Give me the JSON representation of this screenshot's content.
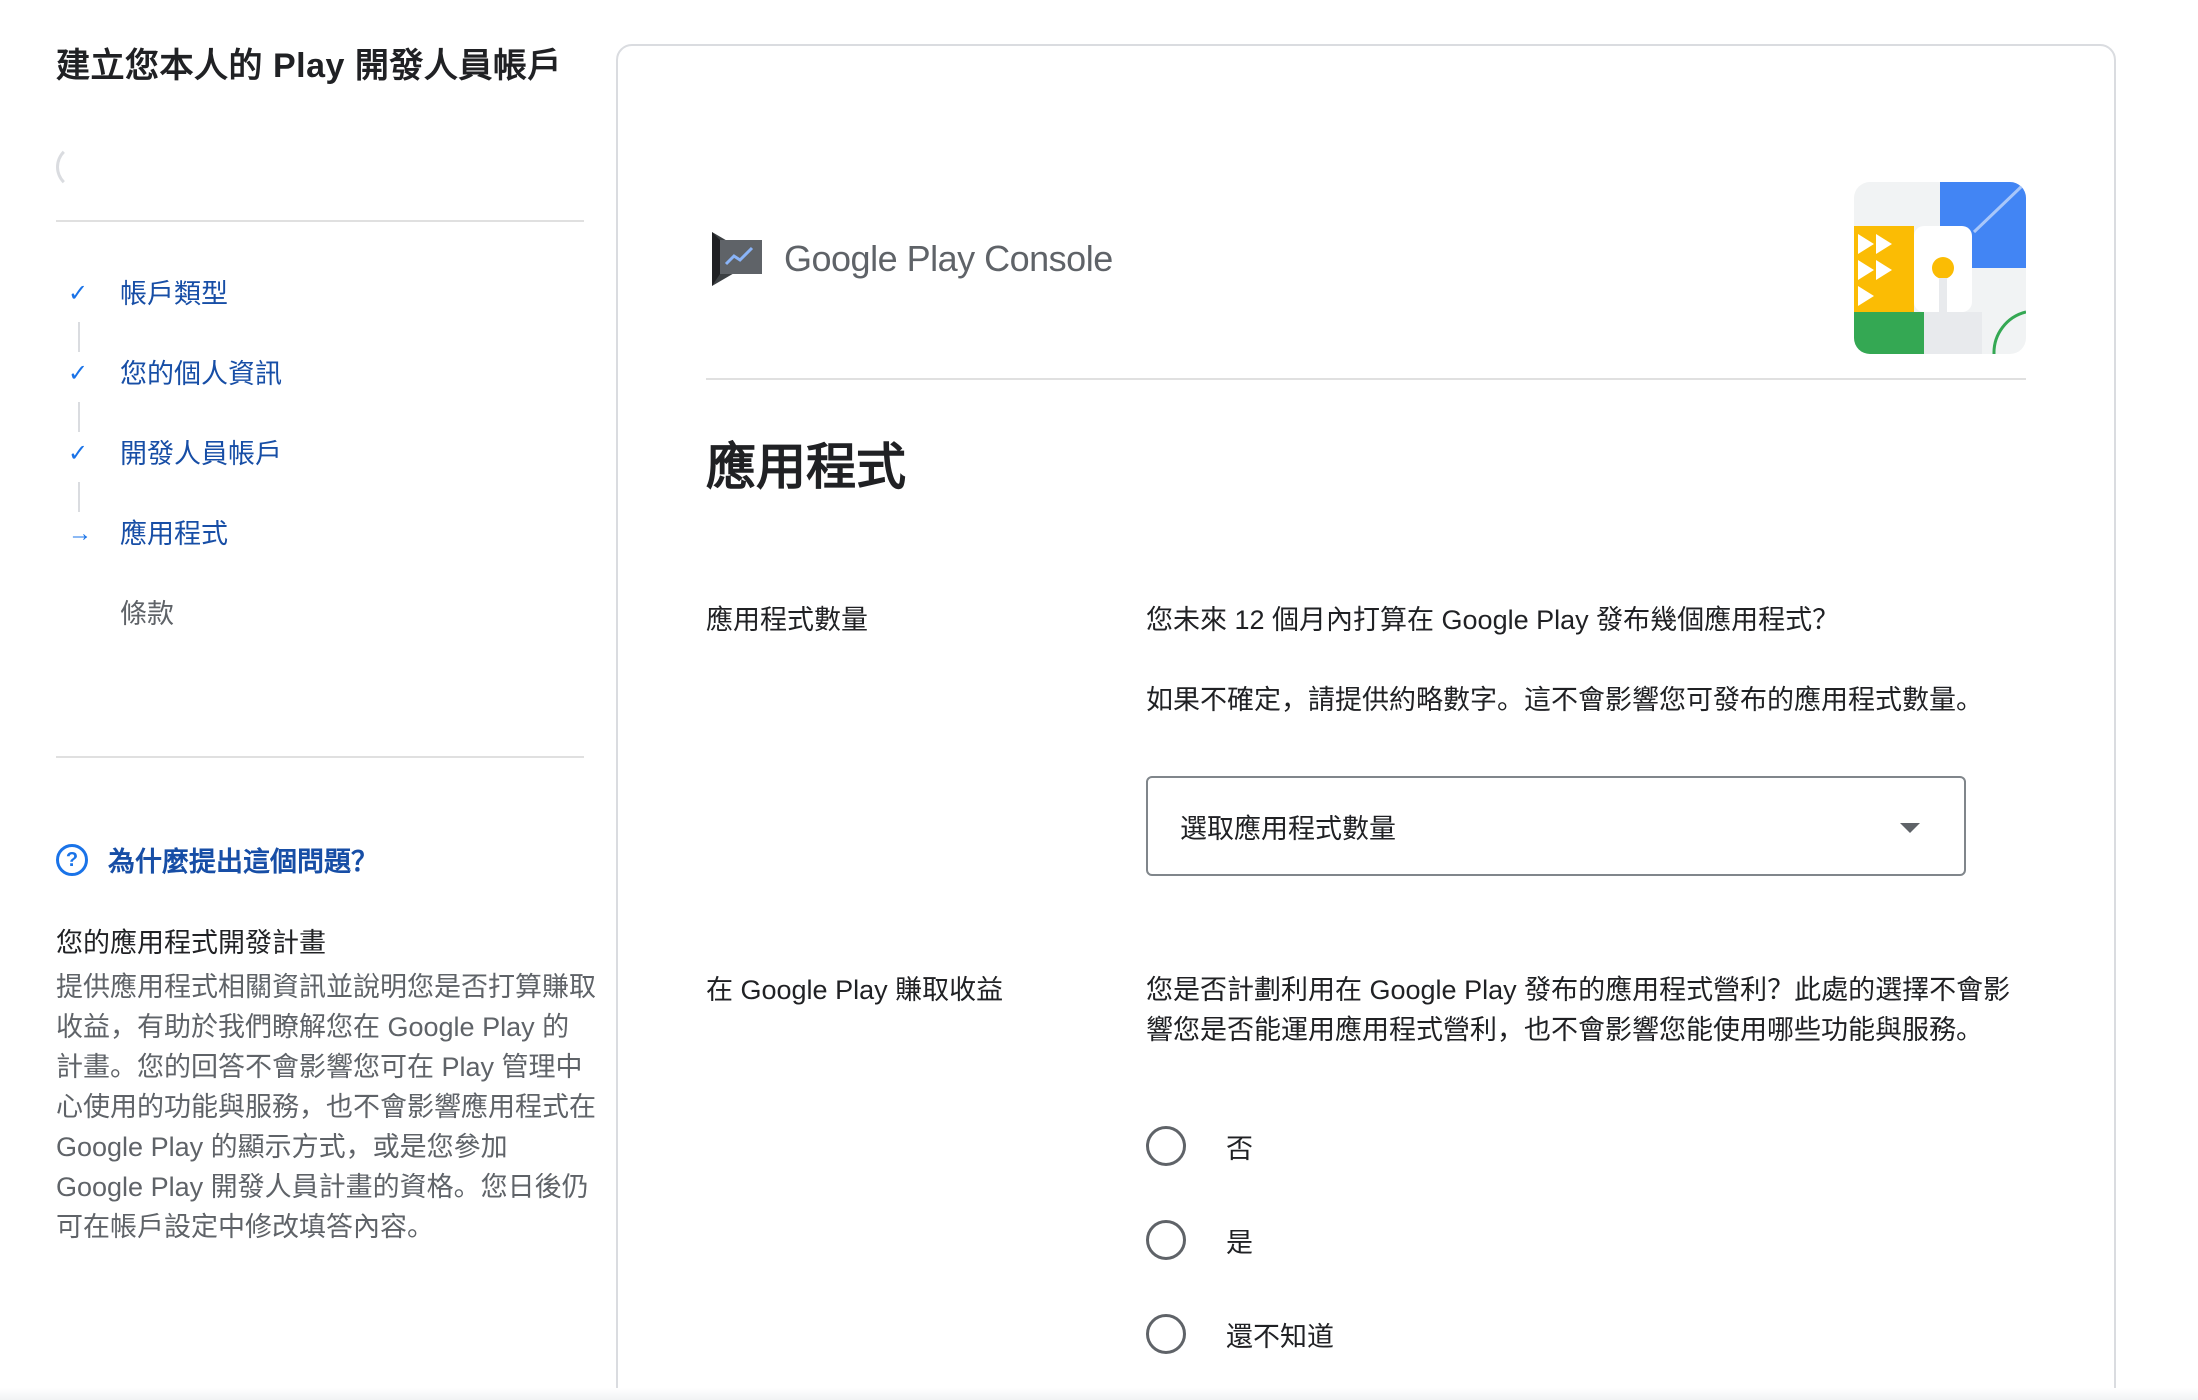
{
  "sidebar": {
    "title": "建立您本人的 Play 開發人員帳戶",
    "steps": [
      {
        "icon": "check-icon",
        "label": "帳戶類型",
        "state": "done"
      },
      {
        "icon": "check-icon",
        "label": "您的個人資訊",
        "state": "done"
      },
      {
        "icon": "check-icon",
        "label": "開發人員帳戶",
        "state": "done"
      },
      {
        "icon": "arrow-right-icon",
        "label": "應用程式",
        "state": "current"
      },
      {
        "icon": "",
        "label": "條款",
        "state": "pending"
      }
    ],
    "why_title": "為什麼提出這個問題？",
    "plan_title": "您的應用程式開發計畫",
    "plan_body": "提供應用程式相關資訊並說明您是否打算賺取收益，有助於我們瞭解您在 Google Play 的計畫。您的回答不會影響您可在 Play 管理中心使用的功能與服務，也不會影響應用程式在 Google Play 的顯示方式，或是您參加 Google Play 開發人員計畫的資格。您日後仍可在帳戶設定中修改填答內容。"
  },
  "header": {
    "logo_google_play": "Google Play",
    "logo_console": "Console"
  },
  "main": {
    "section_title": "應用程式",
    "app_count": {
      "label": "應用程式數量",
      "question": "您未來 12 個月內打算在 Google Play 發布幾個應用程式？",
      "hint": "如果不確定，請提供約略數字。這不會影響您可發布的應用程式數量。",
      "select_placeholder": "選取應用程式數量"
    },
    "monetize": {
      "label": "在 Google Play 賺取收益",
      "question": "您是否計劃利用在 Google Play 發布的應用程式營利？此處的選擇不會影響您是否能運用應用程式營利，也不會影響您能使用哪些功能與服務。",
      "options": [
        "否",
        "是",
        "還不知道"
      ]
    }
  },
  "colors": {
    "accent": "#1a73e8",
    "link_text": "#174ea6",
    "muted_text": "#5f6368",
    "border": "#dadce0"
  }
}
